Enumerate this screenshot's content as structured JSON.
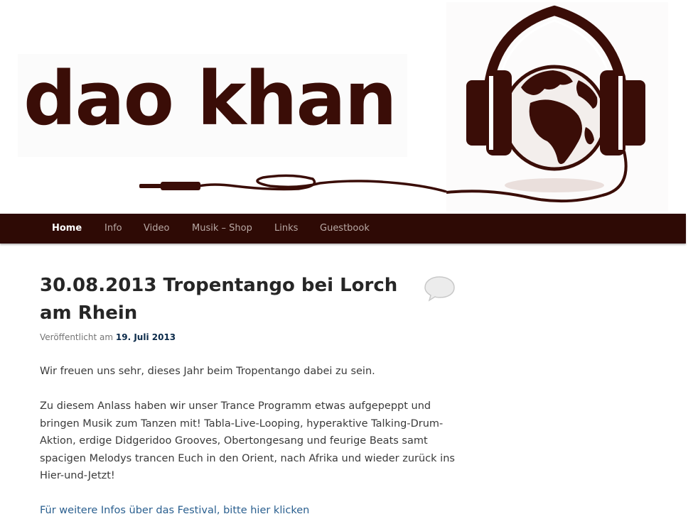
{
  "site": {
    "logo_text": "dao khan"
  },
  "nav": {
    "items": [
      {
        "label": "Home",
        "active": true
      },
      {
        "label": "Info",
        "active": false
      },
      {
        "label": "Video",
        "active": false
      },
      {
        "label": "Musik – Shop",
        "active": false
      },
      {
        "label": "Links",
        "active": false
      },
      {
        "label": "Guestbook",
        "active": false
      }
    ]
  },
  "post": {
    "title": "30.08.2013 Tropentango bei Lorch am Rhein",
    "meta_prefix": "Veröffentlicht am",
    "meta_date": "19. Juli 2013",
    "paragraph_1": "Wir freuen uns sehr, dieses Jahr beim Tropentango dabei zu sein.",
    "paragraph_2": "Zu diesem Anlass haben wir unser Trance Programm etwas aufgepeppt und bringen Musik zum Tanzen mit! Tabla-Live-Looping, hyperaktive Talking-Drum-Aktion, erdige Didgeridoo Grooves, Obertongesang und feurige Beats samt spacigen Melodys trancen Euch in den Orient, nach Afrika und wieder zurück ins Hier-und-Jetzt!",
    "link_text": "Für weitere Infos über das Festival, bitte hier klicken"
  },
  "icons": {
    "comment": "speech-bubble-icon",
    "headphones": "headphones-globe-icon"
  },
  "colors": {
    "nav_background": "#2e0a05",
    "brand_brown": "#3a0d07",
    "link_blue": "#2a5f8f",
    "date_blue": "#0b2a4a"
  }
}
